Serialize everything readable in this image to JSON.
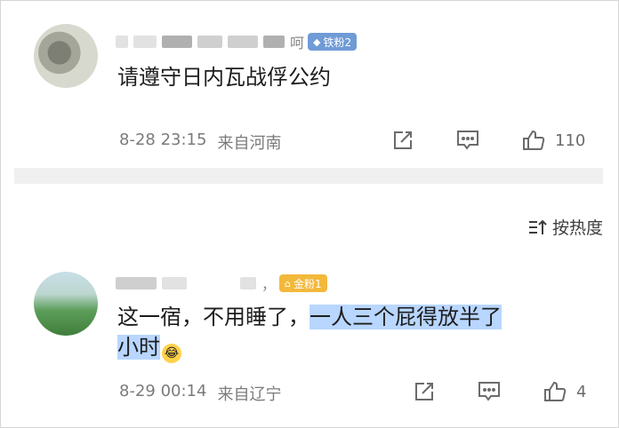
{
  "comments": [
    {
      "name_visible_suffix": "呵",
      "badge": {
        "label": "铁粉2",
        "color": "#6f9bd6"
      },
      "text": "请遵守日内瓦战俘公约",
      "date": "8-28 23:15",
      "location": "来自河南",
      "like_count": "110"
    },
    {
      "name_visible_suffix": "，",
      "badge": {
        "label": "金粉1",
        "color": "#f3b93b"
      },
      "text_plain": "这一宿，不用睡了，",
      "text_highlight_1": "一人三个屁得放半了",
      "text_highlight_2": "小时",
      "emoji": "laugh-cry-emoji",
      "date": "8-29 00:14",
      "location": "来自辽宁",
      "like_count": "4"
    }
  ],
  "sort_label": "按热度",
  "icons": {
    "share": "share-icon",
    "comment": "comment-icon",
    "like": "thumbs-up-icon",
    "sort": "sort-icon"
  }
}
